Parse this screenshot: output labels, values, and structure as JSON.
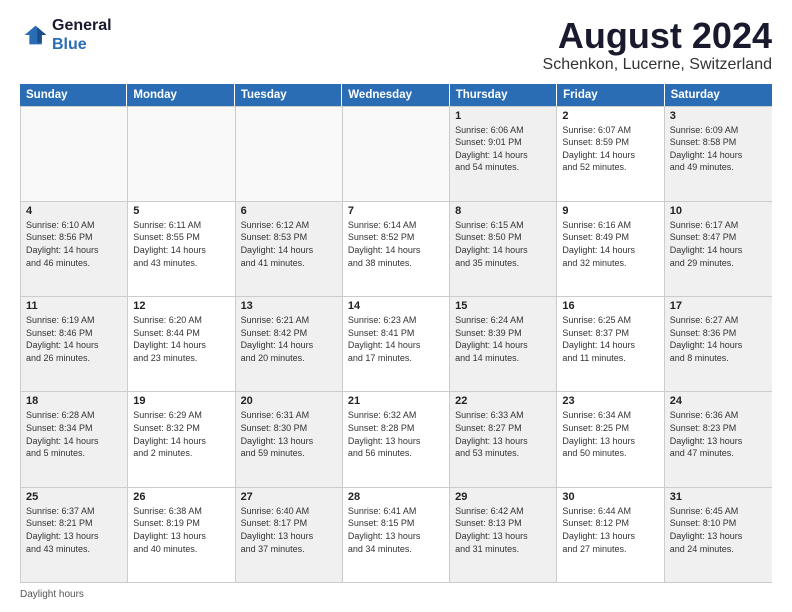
{
  "logo": {
    "line1": "General",
    "line2": "Blue"
  },
  "title": "August 2024",
  "subtitle": "Schenkon, Lucerne, Switzerland",
  "days": [
    "Sunday",
    "Monday",
    "Tuesday",
    "Wednesday",
    "Thursday",
    "Friday",
    "Saturday"
  ],
  "footer": "Daylight hours",
  "weeks": [
    [
      {
        "day": "",
        "text": ""
      },
      {
        "day": "",
        "text": ""
      },
      {
        "day": "",
        "text": ""
      },
      {
        "day": "",
        "text": ""
      },
      {
        "day": "1",
        "text": "Sunrise: 6:06 AM\nSunset: 9:01 PM\nDaylight: 14 hours\nand 54 minutes."
      },
      {
        "day": "2",
        "text": "Sunrise: 6:07 AM\nSunset: 8:59 PM\nDaylight: 14 hours\nand 52 minutes."
      },
      {
        "day": "3",
        "text": "Sunrise: 6:09 AM\nSunset: 8:58 PM\nDaylight: 14 hours\nand 49 minutes."
      }
    ],
    [
      {
        "day": "4",
        "text": "Sunrise: 6:10 AM\nSunset: 8:56 PM\nDaylight: 14 hours\nand 46 minutes."
      },
      {
        "day": "5",
        "text": "Sunrise: 6:11 AM\nSunset: 8:55 PM\nDaylight: 14 hours\nand 43 minutes."
      },
      {
        "day": "6",
        "text": "Sunrise: 6:12 AM\nSunset: 8:53 PM\nDaylight: 14 hours\nand 41 minutes."
      },
      {
        "day": "7",
        "text": "Sunrise: 6:14 AM\nSunset: 8:52 PM\nDaylight: 14 hours\nand 38 minutes."
      },
      {
        "day": "8",
        "text": "Sunrise: 6:15 AM\nSunset: 8:50 PM\nDaylight: 14 hours\nand 35 minutes."
      },
      {
        "day": "9",
        "text": "Sunrise: 6:16 AM\nSunset: 8:49 PM\nDaylight: 14 hours\nand 32 minutes."
      },
      {
        "day": "10",
        "text": "Sunrise: 6:17 AM\nSunset: 8:47 PM\nDaylight: 14 hours\nand 29 minutes."
      }
    ],
    [
      {
        "day": "11",
        "text": "Sunrise: 6:19 AM\nSunset: 8:46 PM\nDaylight: 14 hours\nand 26 minutes."
      },
      {
        "day": "12",
        "text": "Sunrise: 6:20 AM\nSunset: 8:44 PM\nDaylight: 14 hours\nand 23 minutes."
      },
      {
        "day": "13",
        "text": "Sunrise: 6:21 AM\nSunset: 8:42 PM\nDaylight: 14 hours\nand 20 minutes."
      },
      {
        "day": "14",
        "text": "Sunrise: 6:23 AM\nSunset: 8:41 PM\nDaylight: 14 hours\nand 17 minutes."
      },
      {
        "day": "15",
        "text": "Sunrise: 6:24 AM\nSunset: 8:39 PM\nDaylight: 14 hours\nand 14 minutes."
      },
      {
        "day": "16",
        "text": "Sunrise: 6:25 AM\nSunset: 8:37 PM\nDaylight: 14 hours\nand 11 minutes."
      },
      {
        "day": "17",
        "text": "Sunrise: 6:27 AM\nSunset: 8:36 PM\nDaylight: 14 hours\nand 8 minutes."
      }
    ],
    [
      {
        "day": "18",
        "text": "Sunrise: 6:28 AM\nSunset: 8:34 PM\nDaylight: 14 hours\nand 5 minutes."
      },
      {
        "day": "19",
        "text": "Sunrise: 6:29 AM\nSunset: 8:32 PM\nDaylight: 14 hours\nand 2 minutes."
      },
      {
        "day": "20",
        "text": "Sunrise: 6:31 AM\nSunset: 8:30 PM\nDaylight: 13 hours\nand 59 minutes."
      },
      {
        "day": "21",
        "text": "Sunrise: 6:32 AM\nSunset: 8:28 PM\nDaylight: 13 hours\nand 56 minutes."
      },
      {
        "day": "22",
        "text": "Sunrise: 6:33 AM\nSunset: 8:27 PM\nDaylight: 13 hours\nand 53 minutes."
      },
      {
        "day": "23",
        "text": "Sunrise: 6:34 AM\nSunset: 8:25 PM\nDaylight: 13 hours\nand 50 minutes."
      },
      {
        "day": "24",
        "text": "Sunrise: 6:36 AM\nSunset: 8:23 PM\nDaylight: 13 hours\nand 47 minutes."
      }
    ],
    [
      {
        "day": "25",
        "text": "Sunrise: 6:37 AM\nSunset: 8:21 PM\nDaylight: 13 hours\nand 43 minutes."
      },
      {
        "day": "26",
        "text": "Sunrise: 6:38 AM\nSunset: 8:19 PM\nDaylight: 13 hours\nand 40 minutes."
      },
      {
        "day": "27",
        "text": "Sunrise: 6:40 AM\nSunset: 8:17 PM\nDaylight: 13 hours\nand 37 minutes."
      },
      {
        "day": "28",
        "text": "Sunrise: 6:41 AM\nSunset: 8:15 PM\nDaylight: 13 hours\nand 34 minutes."
      },
      {
        "day": "29",
        "text": "Sunrise: 6:42 AM\nSunset: 8:13 PM\nDaylight: 13 hours\nand 31 minutes."
      },
      {
        "day": "30",
        "text": "Sunrise: 6:44 AM\nSunset: 8:12 PM\nDaylight: 13 hours\nand 27 minutes."
      },
      {
        "day": "31",
        "text": "Sunrise: 6:45 AM\nSunset: 8:10 PM\nDaylight: 13 hours\nand 24 minutes."
      }
    ]
  ]
}
